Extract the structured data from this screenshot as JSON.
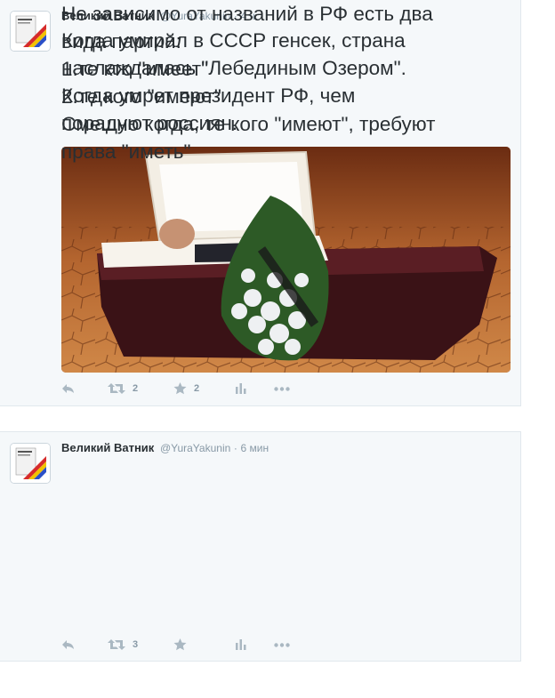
{
  "tweets": [
    {
      "name": "Великий Ватник",
      "handle": "@YuraYakunin",
      "separator": "·",
      "time": "4 ч.",
      "text": "Когда умирал в СССР генсек, страна\nнаслаждалась \"Лебединым Озером\".\nКогда умрет президент РФ, чем\nпорадуют россиян.",
      "media": "coffin-photo",
      "retweets": "2",
      "favorites": "2"
    },
    {
      "name": "Великий Ватник",
      "handle": "@YuraYakunin",
      "separator": "·",
      "time": "6 мин",
      "text": "Не зависимо от названий в РФ есть два\nвида партий:\n1.те кто \"имеет\"\n2.те кого \"имеют\"\nСмешно когда, те кого \"имеют\", требуют\nправа  \"иметь\"",
      "retweets": "3",
      "favorites": ""
    }
  ],
  "icons": {
    "reply": "reply-icon",
    "retweet": "retweet-icon",
    "favorite": "star-icon",
    "stats": "bar-chart-icon",
    "more": "more-dots-icon"
  },
  "colors": {
    "card_bg": "#f5f8fa",
    "text": "#292f33",
    "muted": "#8899a6",
    "icon": "#aab8c2"
  }
}
